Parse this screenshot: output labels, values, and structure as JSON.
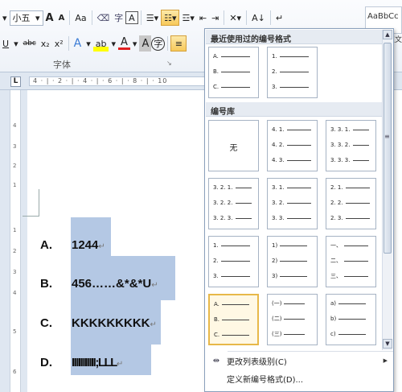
{
  "ribbon": {
    "font_size": "小五",
    "group_font_label": "字体",
    "styles_preview": "AaBbCc",
    "styles_preview2": "正文",
    "buttons_row1": [
      "A",
      "A",
      "Aa",
      "A"
    ],
    "buttons_row2": [
      "U",
      "abc",
      "x₂",
      "x²",
      "A",
      "A",
      "A",
      "字"
    ]
  },
  "ruler": {
    "tab_marker": "L",
    "ticks": "4  ·  |  ·  2  ·  |  ·  4  ·  |  ·  6  ·  |  ·  8  ·  |  ·  10"
  },
  "vruler_ticks": [
    "4",
    "3",
    "2",
    "1",
    "1",
    "2",
    "3",
    "4",
    "5",
    "6"
  ],
  "document": {
    "items": [
      {
        "letter": "A.",
        "text": "1244"
      },
      {
        "letter": "B.",
        "text": "456……&*&*U"
      },
      {
        "letter": "C.",
        "text": "KKKKKKKKK"
      },
      {
        "letter": "D.",
        "text": "IIIIIIIIIII;LLL"
      }
    ]
  },
  "numbering_panel": {
    "recent_title": "最近使用过的编号格式",
    "library_title": "编号库",
    "recent": [
      {
        "lines": [
          "A.",
          "B.",
          "C."
        ]
      },
      {
        "lines": [
          "1.",
          "2.",
          "3."
        ]
      }
    ],
    "library": [
      {
        "none": "无"
      },
      {
        "lines": [
          "4. 1.",
          "4. 2.",
          "4. 3."
        ]
      },
      {
        "lines": [
          "3. 3. 1.",
          "3. 3. 2.",
          "3. 3. 3."
        ]
      },
      {
        "lines": [
          "3. 2. 1.",
          "3. 2. 2.",
          "3. 2. 3."
        ]
      },
      {
        "lines": [
          "3. 1.",
          "3. 2.",
          "3. 3."
        ]
      },
      {
        "lines": [
          "2. 1.",
          "2. 2.",
          "2. 3."
        ]
      },
      {
        "lines": [
          "1.",
          "2.",
          "3."
        ]
      },
      {
        "lines": [
          "1)",
          "2)",
          "3)"
        ]
      },
      {
        "lines": [
          "一、",
          "二、",
          "三、"
        ]
      },
      {
        "lines": [
          "A.",
          "B.",
          "C."
        ]
      },
      {
        "lines": [
          "(一)",
          "(二)",
          "(三)"
        ]
      },
      {
        "lines": [
          "a)",
          "b)",
          "c)"
        ]
      }
    ],
    "menu": [
      {
        "label": "更改列表级别(C)"
      },
      {
        "label": "定义新编号格式(D)..."
      }
    ]
  },
  "colors": {
    "selection": "#b4c8e4",
    "selected_tile_border": "#e7b849",
    "active_button": "#f7c95b"
  }
}
